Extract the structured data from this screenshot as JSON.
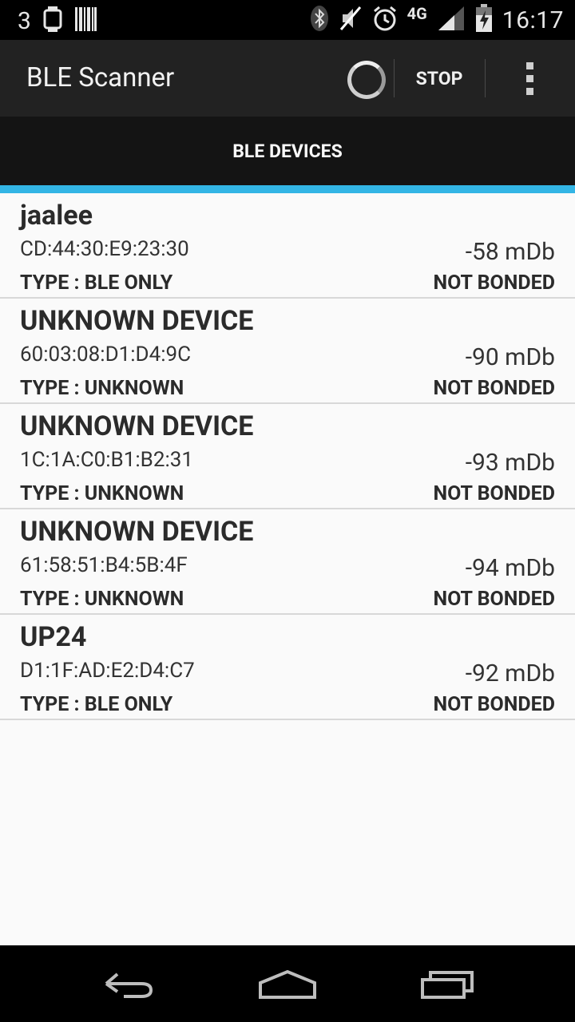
{
  "status_bar": {
    "notification_count": "3",
    "network": "4G",
    "time": "16:17",
    "icons": [
      "watch-icon",
      "barcode-icon",
      "bluetooth-icon",
      "muted-icon",
      "alarm-icon",
      "signal-icon",
      "battery-charging-icon"
    ]
  },
  "action_bar": {
    "title": "BLE Scanner",
    "stop_label": "STOP"
  },
  "tabs": [
    {
      "label": "BLE DEVICES"
    }
  ],
  "devices": [
    {
      "name": "jaalee",
      "address": "CD:44:30:E9:23:30",
      "rssi": "-58 mDb",
      "type": "TYPE : BLE ONLY",
      "bond": "NOT BONDED"
    },
    {
      "name": "UNKNOWN DEVICE",
      "address": "60:03:08:D1:D4:9C",
      "rssi": "-90 mDb",
      "type": "TYPE : UNKNOWN",
      "bond": "NOT BONDED"
    },
    {
      "name": "UNKNOWN DEVICE",
      "address": "1C:1A:C0:B1:B2:31",
      "rssi": "-93 mDb",
      "type": "TYPE : UNKNOWN",
      "bond": "NOT BONDED"
    },
    {
      "name": "UNKNOWN DEVICE",
      "address": "61:58:51:B4:5B:4F",
      "rssi": "-94 mDb",
      "type": "TYPE : UNKNOWN",
      "bond": "NOT BONDED"
    },
    {
      "name": "UP24",
      "address": "D1:1F:AD:E2:D4:C7",
      "rssi": "-92 mDb",
      "type": "TYPE : BLE ONLY",
      "bond": "NOT BONDED"
    }
  ],
  "colors": {
    "action_bar": "#222222",
    "tab_bar": "#141414",
    "tab_indicator": "#33b5e5",
    "list_background": "#fafafa"
  }
}
